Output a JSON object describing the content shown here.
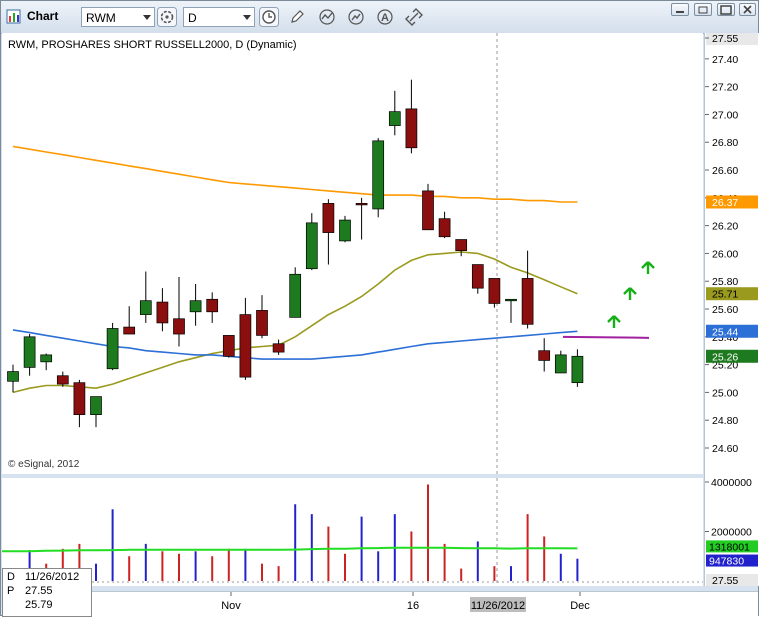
{
  "window": {
    "title": "Chart"
  },
  "toolbar": {
    "symbol": "RWM",
    "interval": "D"
  },
  "chart_title": "RWM, PROSHARES SHORT RUSSELL2000, D (Dynamic)",
  "copyright": "© eSignal, 2012",
  "price_axis": {
    "ticks": [
      "27.55",
      "27.40",
      "27.20",
      "27.00",
      "26.80",
      "26.60",
      "26.40",
      "26.20",
      "26.00",
      "25.80",
      "25.60",
      "25.40",
      "25.20",
      "25.00",
      "24.80",
      "24.60"
    ]
  },
  "price_tags": [
    {
      "label": "26.37",
      "color": "#ff9900"
    },
    {
      "label": "25.71",
      "color": "#9a9a1e"
    },
    {
      "label": "25.44",
      "color": "#2c6fd6"
    },
    {
      "label": "25.26",
      "color": "#1e7a1e"
    }
  ],
  "volume_axis": {
    "ticks": [
      "4000000",
      "2000000"
    ],
    "tags": [
      {
        "label": "1318001",
        "color": "#22cc22"
      },
      {
        "label": "947830",
        "color": "#2222cc"
      }
    ],
    "bottom": "27.55"
  },
  "x_axis": {
    "labels": [
      "Nov",
      "16",
      "11/26/2012",
      "Dec"
    ]
  },
  "info_panel": {
    "rows": [
      {
        "k": "D",
        "v": "11/26/2012"
      },
      {
        "k": "P",
        "v": "27.55"
      },
      {
        "k": "",
        "v": "25.79"
      }
    ]
  },
  "chart_data": {
    "type": "candlestick",
    "price_range": [
      24.44,
      27.6
    ],
    "candles": [
      {
        "o": 25.08,
        "h": 25.2,
        "l": 25.0,
        "c": 25.15
      },
      {
        "o": 25.18,
        "h": 25.42,
        "l": 25.12,
        "c": 25.4
      },
      {
        "o": 25.22,
        "h": 25.28,
        "l": 25.16,
        "c": 25.27
      },
      {
        "o": 25.12,
        "h": 25.15,
        "l": 25.04,
        "c": 25.06
      },
      {
        "o": 25.07,
        "h": 25.09,
        "l": 24.75,
        "c": 24.84
      },
      {
        "o": 24.84,
        "h": 24.96,
        "l": 24.75,
        "c": 24.97
      },
      {
        "o": 25.17,
        "h": 25.5,
        "l": 25.16,
        "c": 25.46
      },
      {
        "o": 25.47,
        "h": 25.62,
        "l": 25.42,
        "c": 25.42
      },
      {
        "o": 25.56,
        "h": 25.87,
        "l": 25.5,
        "c": 25.66
      },
      {
        "o": 25.65,
        "h": 25.75,
        "l": 25.44,
        "c": 25.5
      },
      {
        "o": 25.53,
        "h": 25.83,
        "l": 25.33,
        "c": 25.42
      },
      {
        "o": 25.58,
        "h": 25.78,
        "l": 25.48,
        "c": 25.66
      },
      {
        "o": 25.67,
        "h": 25.72,
        "l": 25.5,
        "c": 25.58
      },
      {
        "o": 25.41,
        "h": 25.41,
        "l": 25.25,
        "c": 25.26
      },
      {
        "o": 25.56,
        "h": 25.68,
        "l": 25.09,
        "c": 25.11
      },
      {
        "o": 25.59,
        "h": 25.7,
        "l": 25.39,
        "c": 25.41
      },
      {
        "o": 25.35,
        "h": 25.38,
        "l": 25.27,
        "c": 25.29
      },
      {
        "o": 25.54,
        "h": 25.9,
        "l": 25.54,
        "c": 25.85
      },
      {
        "o": 25.89,
        "h": 26.29,
        "l": 25.88,
        "c": 26.22
      },
      {
        "o": 26.36,
        "h": 26.39,
        "l": 25.92,
        "c": 26.15
      },
      {
        "o": 26.09,
        "h": 26.27,
        "l": 26.08,
        "c": 26.24
      },
      {
        "o": 26.36,
        "h": 26.4,
        "l": 26.1,
        "c": 26.35
      },
      {
        "o": 26.32,
        "h": 26.83,
        "l": 26.26,
        "c": 26.81
      },
      {
        "o": 26.92,
        "h": 27.17,
        "l": 26.85,
        "c": 27.02
      },
      {
        "o": 27.04,
        "h": 27.25,
        "l": 26.72,
        "c": 26.76
      },
      {
        "o": 26.45,
        "h": 26.5,
        "l": 26.17,
        "c": 26.17
      },
      {
        "o": 26.25,
        "h": 26.3,
        "l": 26.11,
        "c": 26.12
      },
      {
        "o": 26.1,
        "h": 26.1,
        "l": 25.98,
        "c": 26.02
      },
      {
        "o": 25.92,
        "h": 25.92,
        "l": 25.71,
        "c": 25.75
      },
      {
        "o": 25.82,
        "h": 25.82,
        "l": 25.61,
        "c": 25.64
      },
      {
        "o": 25.67,
        "h": 25.67,
        "l": 25.5,
        "c": 25.67
      },
      {
        "o": 25.82,
        "h": 26.02,
        "l": 25.46,
        "c": 25.49
      },
      {
        "o": 25.3,
        "h": 25.39,
        "l": 25.15,
        "c": 25.23
      },
      {
        "o": 25.14,
        "h": 25.3,
        "l": 25.14,
        "c": 25.27
      },
      {
        "o": 25.07,
        "h": 25.31,
        "l": 25.04,
        "c": 25.26
      }
    ],
    "volume": [
      {
        "v": 380000,
        "up": true
      },
      {
        "v": 1250000,
        "up": true
      },
      {
        "v": 700000,
        "up": false
      },
      {
        "v": 1300000,
        "up": false
      },
      {
        "v": 1500000,
        "up": false
      },
      {
        "v": 700000,
        "up": true
      },
      {
        "v": 2900000,
        "up": true
      },
      {
        "v": 1000000,
        "up": false
      },
      {
        "v": 1500000,
        "up": true
      },
      {
        "v": 1200000,
        "up": false
      },
      {
        "v": 1100000,
        "up": false
      },
      {
        "v": 1200000,
        "up": true
      },
      {
        "v": 1000000,
        "up": false
      },
      {
        "v": 1300000,
        "up": false
      },
      {
        "v": 1300000,
        "up": true
      },
      {
        "v": 700000,
        "up": false
      },
      {
        "v": 600000,
        "up": false
      },
      {
        "v": 3100000,
        "up": true
      },
      {
        "v": 2700000,
        "up": true
      },
      {
        "v": 2200000,
        "up": false
      },
      {
        "v": 1100000,
        "up": false
      },
      {
        "v": 2600000,
        "up": true
      },
      {
        "v": 1200000,
        "up": true
      },
      {
        "v": 2700000,
        "up": true
      },
      {
        "v": 2000000,
        "up": false
      },
      {
        "v": 3900000,
        "up": false
      },
      {
        "v": 1500000,
        "up": false
      },
      {
        "v": 500000,
        "up": false
      },
      {
        "v": 1600000,
        "up": true
      },
      {
        "v": 600000,
        "up": false
      },
      {
        "v": 600000,
        "up": true
      },
      {
        "v": 2700000,
        "up": false
      },
      {
        "v": 1800000,
        "up": false
      },
      {
        "v": 1100000,
        "up": true
      },
      {
        "v": 900000,
        "up": true
      }
    ],
    "volume_range": [
      0,
      4300000
    ],
    "sma_orange": [
      26.77,
      26.75,
      26.73,
      26.71,
      26.69,
      26.67,
      26.65,
      26.63,
      26.61,
      26.59,
      26.57,
      26.55,
      26.53,
      26.51,
      26.5,
      26.49,
      26.48,
      26.47,
      26.46,
      26.45,
      26.44,
      26.43,
      26.42,
      26.42,
      26.42,
      26.41,
      26.41,
      26.4,
      26.4,
      26.39,
      26.39,
      26.38,
      26.38,
      26.37,
      26.37
    ],
    "sma_olive": [
      25.0,
      25.03,
      25.05,
      25.05,
      25.04,
      25.03,
      25.06,
      25.1,
      25.14,
      25.18,
      25.22,
      25.25,
      25.28,
      25.3,
      25.32,
      25.33,
      25.34,
      25.4,
      25.48,
      25.56,
      25.62,
      25.69,
      25.78,
      25.88,
      25.95,
      25.99,
      26.0,
      26.01,
      26.0,
      25.96,
      25.9,
      25.86,
      25.81,
      25.76,
      25.71
    ],
    "sma_blue": [
      25.45,
      25.43,
      25.41,
      25.39,
      25.37,
      25.35,
      25.33,
      25.32,
      25.3,
      25.29,
      25.28,
      25.27,
      25.27,
      25.26,
      25.25,
      25.24,
      25.24,
      25.24,
      25.24,
      25.25,
      25.26,
      25.27,
      25.29,
      25.31,
      25.33,
      25.35,
      25.36,
      25.37,
      25.38,
      25.39,
      25.4,
      25.41,
      25.42,
      25.43,
      25.44
    ],
    "vol_avg": [
      1200000,
      1200000,
      1220000,
      1230000,
      1240000,
      1240000,
      1250000,
      1260000,
      1260000,
      1260000,
      1260000,
      1260000,
      1260000,
      1260000,
      1260000,
      1260000,
      1260000,
      1270000,
      1290000,
      1300000,
      1300000,
      1320000,
      1330000,
      1340000,
      1340000,
      1340000,
      1340000,
      1330000,
      1320000,
      1320000,
      1310000,
      1320000,
      1320000,
      1320000,
      1318001
    ],
    "support_line": 25.4
  }
}
